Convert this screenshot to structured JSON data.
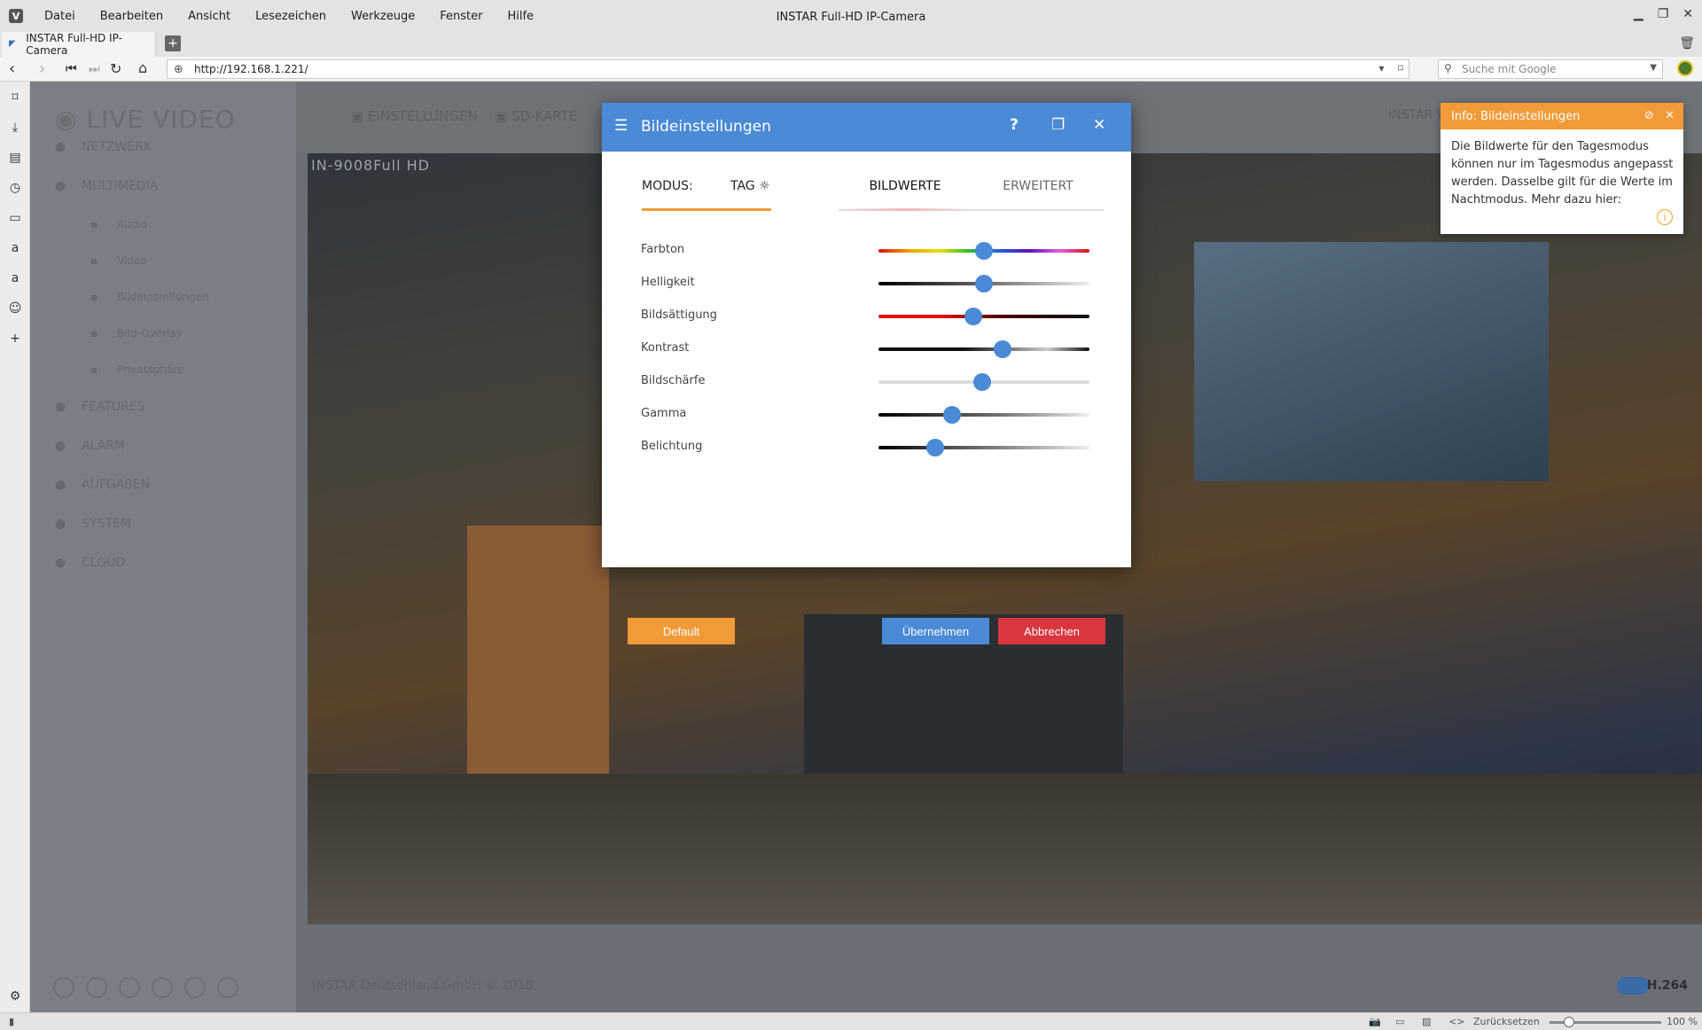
{
  "window": {
    "title": "INSTAR Full-HD IP-Camera",
    "menu": [
      "Datei",
      "Bearbeiten",
      "Ansicht",
      "Lesezeichen",
      "Werkzeuge",
      "Fenster",
      "Hilfe"
    ]
  },
  "tab": {
    "label": "INSTAR Full-HD IP-Camera"
  },
  "address": {
    "url": "http://192.168.1.221/"
  },
  "search": {
    "placeholder": "Suche mit Google"
  },
  "statusbar": {
    "reset": "Zurücksetzen",
    "zoom": "100 %"
  },
  "page": {
    "logo": "LIVE VIDEO",
    "topnav": [
      "EINSTELLUNGEN",
      "SD-KARTE"
    ],
    "topright": "INSTAR Wiki durchsuchen",
    "sidebar": [
      {
        "label": "NETZWERK",
        "sub": false
      },
      {
        "label": "MULTIMEDIA",
        "sub": false
      },
      {
        "label": "Audio",
        "sub": true
      },
      {
        "label": "Video",
        "sub": true
      },
      {
        "label": "Bildeinstellungen",
        "sub": true
      },
      {
        "label": "Bild-Overlay",
        "sub": true
      },
      {
        "label": "Privatsphäre",
        "sub": true
      },
      {
        "label": "FEATURES",
        "sub": false
      },
      {
        "label": "ALARM",
        "sub": false
      },
      {
        "label": "AUFGABEN",
        "sub": false
      },
      {
        "label": "SYSTEM",
        "sub": false
      },
      {
        "label": "CLOUD",
        "sub": false
      }
    ],
    "camera_label": "IN-9008Full HD",
    "footer": "INSTAR Deutschland GmbH © 2018",
    "codec": "H.264"
  },
  "modal": {
    "title": "Bildeinstellungen",
    "modus_label": "MODUS:",
    "modus_value": "TAG ☼",
    "tab_active": "BILDWERTE",
    "tab_inactive": "ERWEITERT",
    "sliders": [
      {
        "label": "Farbton",
        "value": 0.5
      },
      {
        "label": "Helligkeit",
        "value": 0.5
      },
      {
        "label": "Bildsättigung",
        "value": 0.45
      },
      {
        "label": "Kontrast",
        "value": 0.59
      },
      {
        "label": "Bildschärfe",
        "value": 0.49
      },
      {
        "label": "Gamma",
        "value": 0.35
      },
      {
        "label": "Belichtung",
        "value": 0.27
      }
    ],
    "btn_default": "Default",
    "btn_apply": "Übernehmen",
    "btn_cancel": "Abbrechen"
  },
  "info": {
    "title": "Info: Bildeinstellungen",
    "text": "Die Bildwerte für den Tagesmodus können nur im Tagesmodus angepasst werden. Dasselbe gilt für die Werte im Nachtmodus. Mehr dazu hier:"
  },
  "colors": {
    "accent_blue": "#4a8ad6",
    "accent_orange": "#f29a38",
    "cancel_red": "#d9363e"
  }
}
